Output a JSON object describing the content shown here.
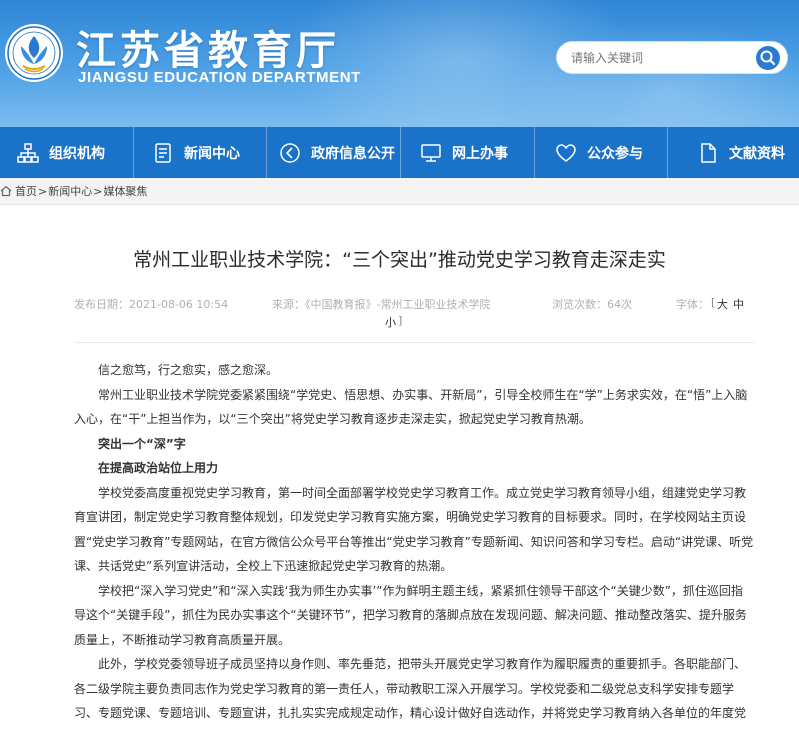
{
  "header": {
    "title": "江苏省教育厅",
    "subtitle": "JIANGSU EDUCATION DEPARTMENT",
    "logo_icon": "jiangsu-education-emblem",
    "search_placeholder": "请输入关键词",
    "search_icon": "search-icon"
  },
  "nav": {
    "items": [
      {
        "label": "组织机构",
        "icon": "org-chart-icon"
      },
      {
        "label": "新闻中心",
        "icon": "news-document-icon"
      },
      {
        "label": "政府信息公开",
        "icon": "info-open-icon"
      },
      {
        "label": "网上办事",
        "icon": "monitor-icon"
      },
      {
        "label": "公众参与",
        "icon": "heart-icon"
      },
      {
        "label": "文献资料",
        "icon": "document-icon"
      }
    ]
  },
  "breadcrumb": {
    "home": "首页",
    "sep": ">",
    "news": "新闻中心",
    "current": "媒体聚焦"
  },
  "article": {
    "title": "常州工业职业技术学院：“三个突出”推动党史学习教育走深走实",
    "date": "发布日期：2021-08-06 10:54",
    "source": "来源：《中国教育报》-常州工业职业技术学院",
    "views": "浏览次数：64次",
    "font_label": "字体：",
    "font_open": "[",
    "font_large": "大",
    "font_medium": "中",
    "font_small": "小",
    "font_close": "]",
    "paragraphs": [
      "信之愈笃，行之愈实，感之愈深。",
      "常州工业职业技术学院党委紧紧围绕“学党史、悟思想、办实事、开新局”，引导全校师生在“学”上务求实效，在“悟”上入脑入心，在“干”上担当作为，以“三个突出”将党史学习教育逐步走深走实，掀起党史学习教育热潮。",
      "突出一个“深”字",
      "在提高政治站位上用力",
      "学校党委高度重视党史学习教育，第一时间全面部署学校党史学习教育工作。成立党史学习教育领导小组，组建党史学习教育宣讲团，制定党史学习教育整体规划，印发党史学习教育实施方案，明确党史学习教育的目标要求。同时，在学校网站主页设置“党史学习教育”专题网站，在官方微信公众号平台等推出“党史学习教育”专题新闻、知识问答和学习专栏。启动“讲党课、听党课、共话党史”系列宣讲活动，全校上下迅速掀起党史学习教育的热潮。",
      "学校把“深入学习党史”和“深入实践‘我为师生办实事’”作为鲜明主题主线，紧紧抓住领导干部这个“关键少数”，抓住巡回指导这个“关键手段”，抓住为民办实事这个“关键环节”，把学习教育的落脚点放在发现问题、解决问题、推动整改落实、提升服务质量上，不断推动学习教育高质量开展。",
      "此外，学校党委领导班子成员坚持以身作则、率先垂范，把带头开展党史学习教育作为履职履责的重要抓手。各职能部门、各二级学院主要负责同志作为党史学习教育的第一责任人，带动教职工深入开展学习。学校党委和二级党总支科学安排专题学习、专题党课、专题培训、专题宣讲，扎扎实实完成规定动作，精心设计做好自选动作，并将党史学习教育纳入各单位的年度党建考核。"
    ]
  },
  "colors": {
    "header_top": "#2f86d6",
    "nav_bg": "#1a72c9",
    "crumb_bg": "#f4f4f4"
  }
}
